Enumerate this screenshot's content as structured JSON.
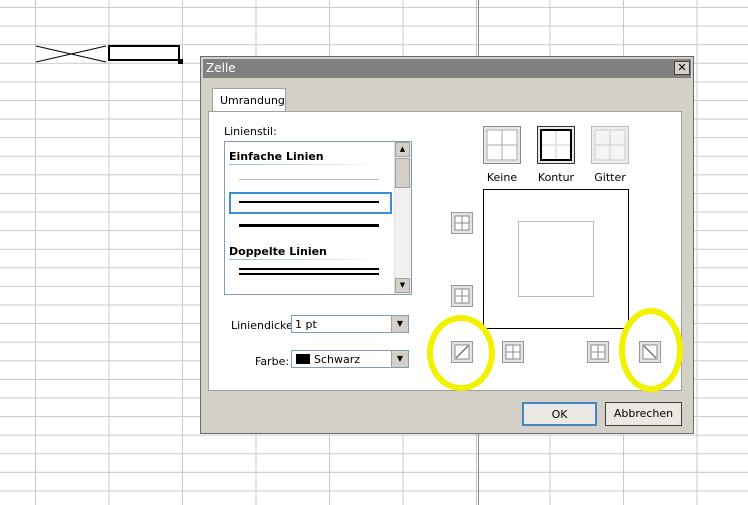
{
  "dialog": {
    "title": "Zelle",
    "close_symbol": "✕"
  },
  "tabs": [
    {
      "label": "Umrandung"
    }
  ],
  "line_style": {
    "label": "Linienstil:",
    "groups": [
      "Einfache Linien",
      "Doppelte Linien"
    ]
  },
  "thickness": {
    "label": "Liniendicke:",
    "value": "1 pt"
  },
  "color": {
    "label": "Farbe:",
    "value": "Schwarz",
    "swatch_hex": "#000000"
  },
  "presets": [
    {
      "label": "Keine"
    },
    {
      "label": "Kontur"
    },
    {
      "label": "Gitter"
    }
  ],
  "buttons": {
    "ok": "OK",
    "cancel": "Abbrechen"
  },
  "colors": {
    "highlight": "#f2f200",
    "selection_border": "#3a8fd6"
  },
  "icons": {
    "close": "close-icon",
    "scroll_up": "scroll-up-icon",
    "scroll_down": "scroll-down-icon",
    "dropdown": "chevron-down-icon"
  }
}
